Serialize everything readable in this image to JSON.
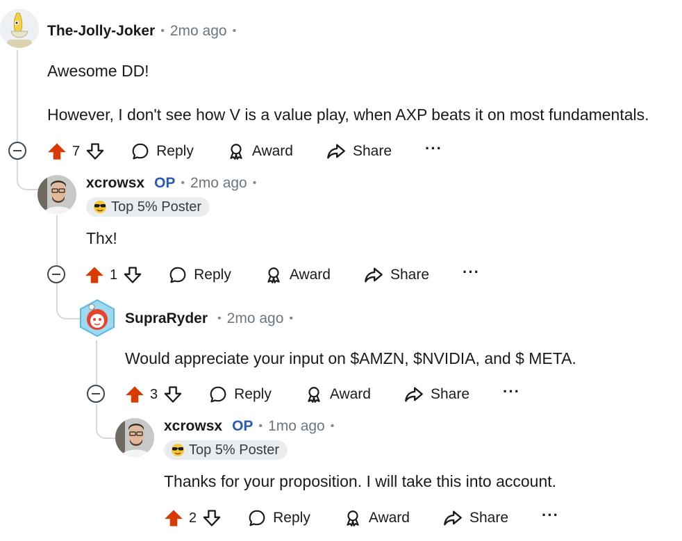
{
  "comments": [
    {
      "username": "The-Jolly-Joker",
      "op_label": "",
      "time": "2mo ago",
      "flair": "",
      "body": [
        "Awesome DD!",
        "However, I don't see how V is a value play, when AXP beats it on most fundamentals."
      ],
      "votes": "7",
      "reply_label": "Reply",
      "award_label": "Award",
      "share_label": "Share",
      "more_label": "···"
    },
    {
      "username": "xcrowsx",
      "op_label": "OP",
      "time": "2mo ago",
      "flair": "Top 5% Poster",
      "body": [
        "Thx!"
      ],
      "votes": "1",
      "reply_label": "Reply",
      "award_label": "Award",
      "share_label": "Share",
      "more_label": "···"
    },
    {
      "username": "SupraRyder",
      "op_label": "",
      "time": "2mo ago",
      "flair": "",
      "body": [
        "Would appreciate your input on $AMZN, $NVIDIA, and $ META."
      ],
      "votes": "3",
      "reply_label": "Reply",
      "award_label": "Award",
      "share_label": "Share",
      "more_label": "···"
    },
    {
      "username": "xcrowsx",
      "op_label": "OP",
      "time": "1mo ago",
      "flair": "Top 5% Poster",
      "body": [
        "Thanks for your proposition. I will take this into account."
      ],
      "votes": "2",
      "reply_label": "Reply",
      "award_label": "Award",
      "share_label": "Share",
      "more_label": "···"
    }
  ],
  "separator": "•",
  "icons": {
    "upvote": "upvote-arrow-icon",
    "downvote": "downvote-arrow-icon",
    "reply": "speech-bubble-icon",
    "award": "award-ribbon-icon",
    "share": "share-arrow-icon",
    "collapse": "collapse-minus-icon",
    "flair": "sunglasses-emoji-icon"
  },
  "colors": {
    "upvote_active": "#d93a00",
    "op": "#2a5db0",
    "meta": "#6b7780",
    "thread_line": "#d4d8dc",
    "flair_bg": "#eaedef"
  }
}
